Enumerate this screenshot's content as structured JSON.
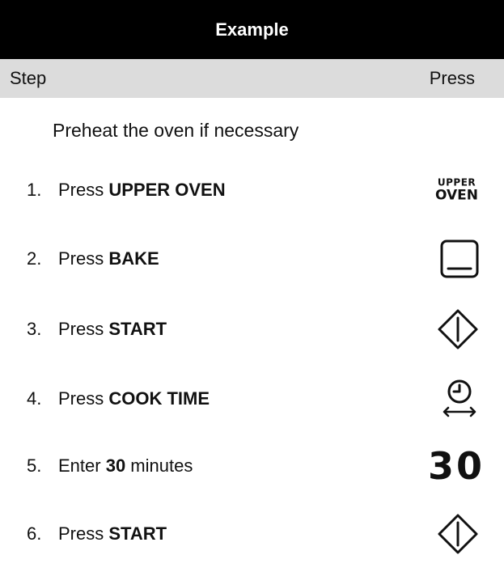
{
  "title": "Example",
  "header": {
    "step_label": "Step",
    "press_label": "Press"
  },
  "intro": "Preheat the oven if necessary",
  "steps": [
    {
      "num": "1.",
      "prefix": "Press ",
      "bold": "UPPER OVEN",
      "suffix": "",
      "icon": "upper-oven-key",
      "key_line1": "UPPER",
      "key_line2": "OVEN"
    },
    {
      "num": "2.",
      "prefix": "Press ",
      "bold": "BAKE",
      "suffix": "",
      "icon": "bake-icon"
    },
    {
      "num": "3.",
      "prefix": "Press ",
      "bold": "START",
      "suffix": "",
      "icon": "start-icon"
    },
    {
      "num": "4.",
      "prefix": "Press ",
      "bold": "COOK TIME",
      "suffix": "",
      "icon": "cook-time-icon"
    },
    {
      "num": "5.",
      "prefix": "Enter ",
      "bold": "30",
      "suffix": " minutes",
      "icon": "number-30",
      "key_value": "30"
    },
    {
      "num": "6.",
      "prefix": "Press ",
      "bold": "START",
      "suffix": "",
      "icon": "start-icon"
    }
  ]
}
